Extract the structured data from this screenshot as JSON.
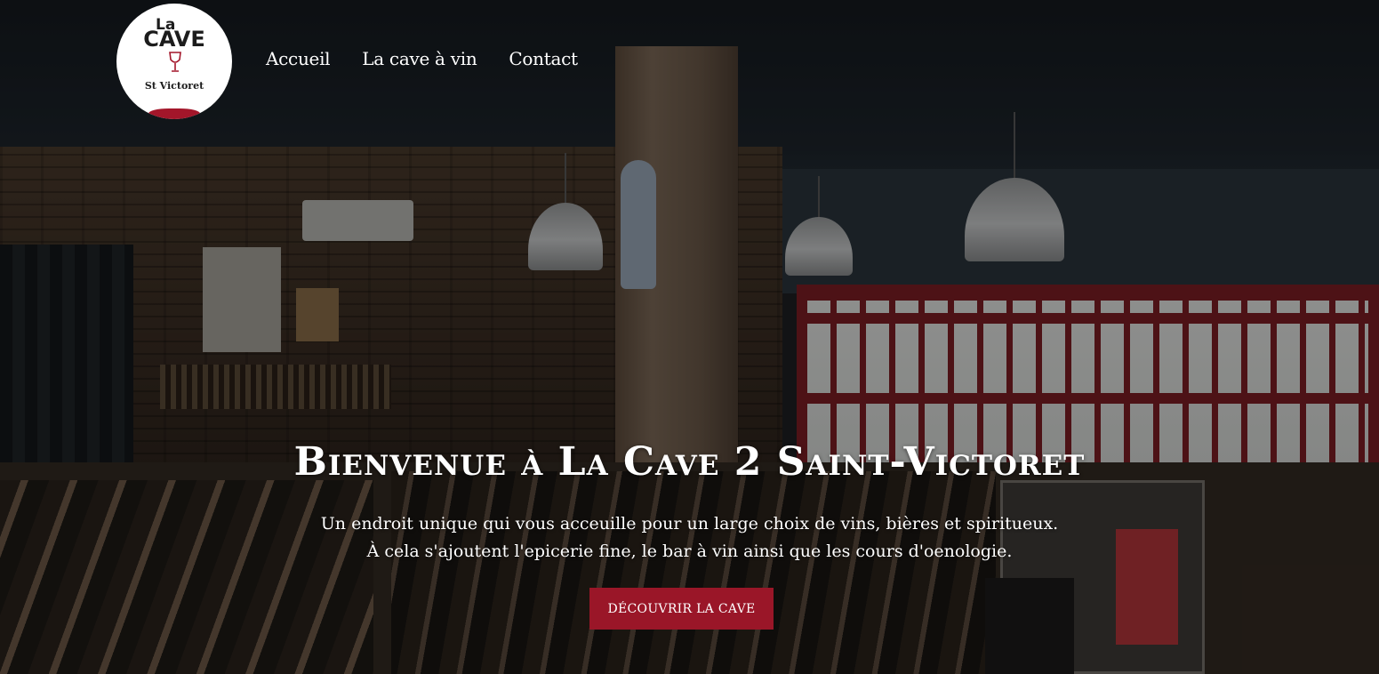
{
  "logo": {
    "line1": "La",
    "line2": "CAVE",
    "line3": "St Victoret",
    "accent_color": "#a3162a"
  },
  "nav": {
    "items": [
      "Accueil",
      "La cave à vin",
      "Contact"
    ]
  },
  "hero": {
    "title": "Bienvenue à La Cave 2 Saint-Victoret",
    "text_line1": "Un endroit unique qui vous acceuille pour un large choix de vins, bières et spiritueux.",
    "text_line2": "À cela s'ajoutent l'epicerie fine, le bar à vin ainsi que les cours d'oenologie.",
    "cta_label": "DÉCOUVRIR LA CAVE",
    "cta_color": "#9a1628"
  }
}
